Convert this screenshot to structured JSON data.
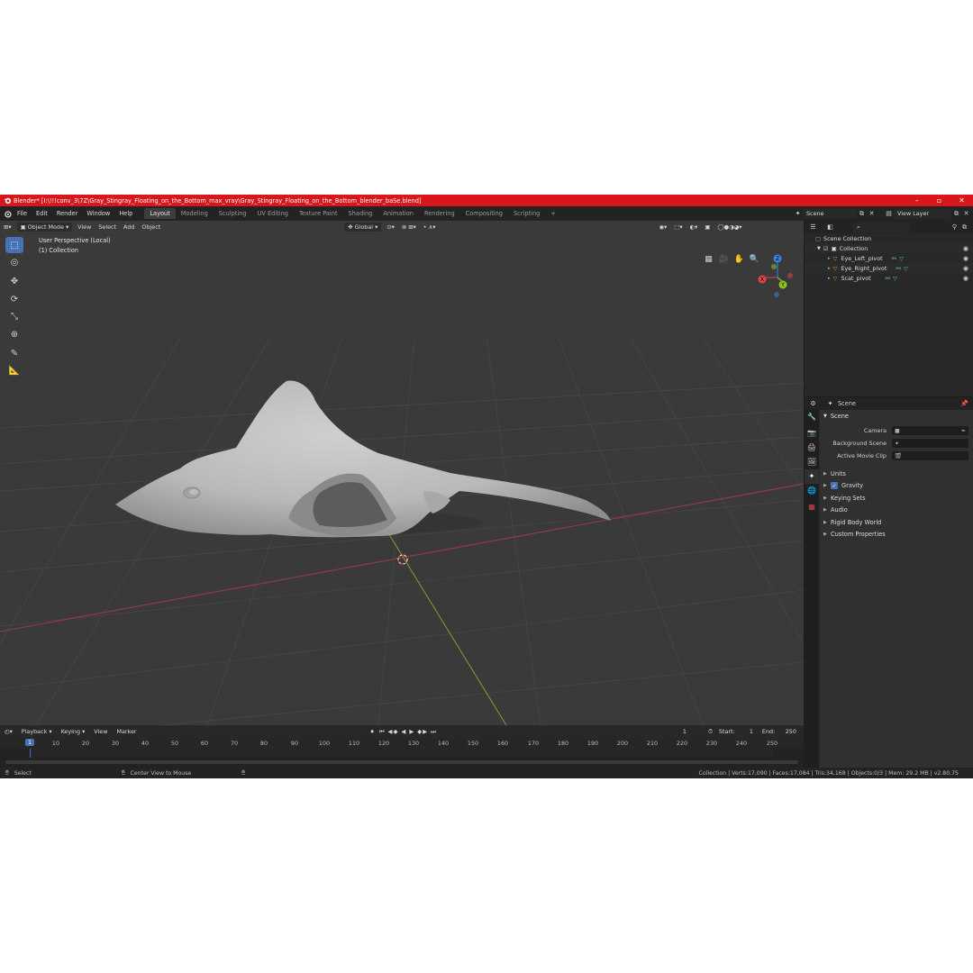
{
  "window": {
    "title": "Blender* [I:\\!!!conv_3\\7Z\\Gray_Stingray_Floating_on_the_Bottom_max_vray\\Gray_Stingray_Floating_on_the_Bottom_blender_baSe.blend]"
  },
  "menu": {
    "items": [
      "File",
      "Edit",
      "Render",
      "Window",
      "Help"
    ]
  },
  "workspaces": [
    "Layout",
    "Modeling",
    "Sculpting",
    "UV Editing",
    "Texture Paint",
    "Shading",
    "Animation",
    "Rendering",
    "Compositing",
    "Scripting"
  ],
  "header_right": {
    "scene": "Scene",
    "view_layer": "View Layer"
  },
  "viewport": {
    "mode": "Object Mode",
    "menus": [
      "View",
      "Select",
      "Add",
      "Object"
    ],
    "transform": "Global",
    "info_line1": "User Perspective (Local)",
    "info_line2": "(1) Collection",
    "gizmo_axes": [
      "X",
      "Y",
      "Z"
    ]
  },
  "outliner": {
    "root": "Scene Collection",
    "collection": "Collection",
    "objects": [
      "Eye_Left_pivot",
      "Eye_Right_pivot",
      "Scat_pivot"
    ]
  },
  "properties": {
    "context": "Scene",
    "panel": "Scene",
    "fields": [
      {
        "label": "Camera",
        "value": ""
      },
      {
        "label": "Background Scene",
        "value": ""
      },
      {
        "label": "Active Movie Clip",
        "value": ""
      }
    ],
    "sections": [
      "Units",
      "Gravity",
      "Keying Sets",
      "Audio",
      "Rigid Body World",
      "Custom Properties"
    ]
  },
  "timeline": {
    "menus": [
      "Playback",
      "Keying",
      "View",
      "Marker"
    ],
    "current_frame": "1",
    "start_label": "Start:",
    "start": "1",
    "end_label": "End:",
    "end": "250",
    "ticks": [
      "10",
      "20",
      "30",
      "40",
      "50",
      "60",
      "70",
      "80",
      "90",
      "100",
      "110",
      "120",
      "130",
      "140",
      "150",
      "160",
      "170",
      "180",
      "190",
      "200",
      "210",
      "220",
      "230",
      "240",
      "250"
    ],
    "frame_marker": "1"
  },
  "status": {
    "select": "Select",
    "center": "Center View to Mouse",
    "stats": "Collection | Verts:17,090 | Faces:17,084 | Tris:34,168 | Objects:0/3 | Mem: 29.2 MB | v2.80.75"
  },
  "colors": {
    "title_bar": "#d9161b",
    "accent": "#4772b3",
    "viewport_bg": "#3a3a3a",
    "x_axis": "#b7404a",
    "y_axis": "#8aa63a"
  }
}
